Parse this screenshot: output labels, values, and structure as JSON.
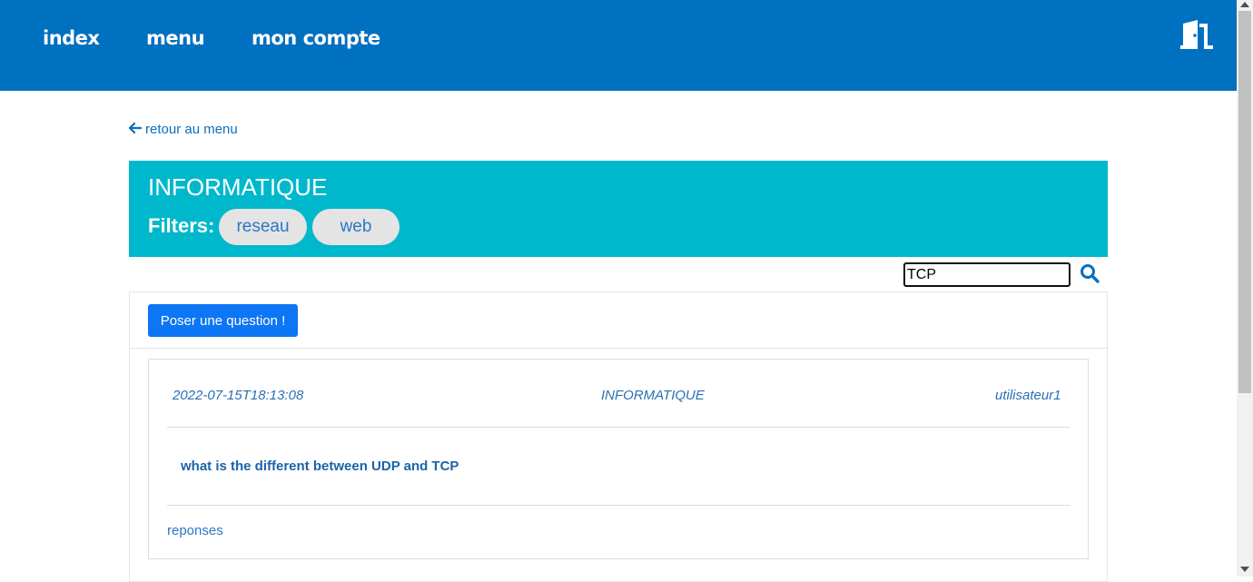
{
  "nav": {
    "items": [
      {
        "label": "index"
      },
      {
        "label": "menu"
      },
      {
        "label": "mon compte"
      }
    ],
    "logout_icon": "door-exit-icon"
  },
  "back_link": {
    "label": "retour au menu",
    "icon": "arrow-left-icon"
  },
  "category": {
    "title": "INFORMATIQUE",
    "filters_label": "Filters:",
    "filters": [
      "reseau",
      "web"
    ]
  },
  "search": {
    "value": "TCP",
    "icon": "search-icon"
  },
  "actions": {
    "ask_label": "Poser une question !"
  },
  "questions": [
    {
      "date": "2022-07-15T18:13:08",
      "category": "INFORMATIQUE",
      "author": "utilisateur1",
      "title": "what is the different between UDP and TCP",
      "answers_label": "reponses"
    }
  ],
  "colors": {
    "topbar": "#0070c0",
    "category_panel": "#00b8cc",
    "primary_button": "#0d76f5",
    "link": "#0d6ebd"
  }
}
